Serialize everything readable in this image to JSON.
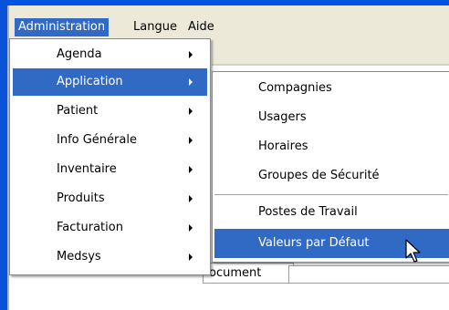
{
  "menubar": {
    "items": [
      {
        "label": "Administration",
        "active": true
      },
      {
        "label": "Langue",
        "active": false
      },
      {
        "label": "Aide",
        "active": false
      }
    ]
  },
  "administration_menu": {
    "items": [
      {
        "label": "Agenda",
        "has_submenu": true,
        "highlighted": false
      },
      {
        "label": "Application",
        "has_submenu": true,
        "highlighted": true
      },
      {
        "label": "Patient",
        "has_submenu": true,
        "highlighted": false
      },
      {
        "label": "Info Générale",
        "has_submenu": true,
        "highlighted": false
      },
      {
        "label": "Inventaire",
        "has_submenu": true,
        "highlighted": false
      },
      {
        "label": "Produits",
        "has_submenu": true,
        "highlighted": false
      },
      {
        "label": "Facturation",
        "has_submenu": true,
        "highlighted": false
      },
      {
        "label": "Medsys",
        "has_submenu": true,
        "highlighted": false
      }
    ]
  },
  "application_submenu": {
    "items": [
      {
        "label": "Compagnies",
        "highlighted": false
      },
      {
        "label": "Usagers",
        "highlighted": false
      },
      {
        "label": "Horaires",
        "highlighted": false
      },
      {
        "label": "Groupes de Sécurité",
        "highlighted": false
      },
      {
        "label": "Postes de Travail",
        "highlighted": false
      },
      {
        "label": "Valeurs par Défaut",
        "highlighted": true
      }
    ]
  },
  "background": {
    "document_tab_label": "ocument"
  },
  "colors": {
    "menubar_bg": "#ece9d8",
    "highlight": "#316ac5",
    "frame_blue": "#0054e3"
  },
  "icons": {
    "submenu_arrow": "triangle-right",
    "cursor": "arrow-pointer"
  }
}
